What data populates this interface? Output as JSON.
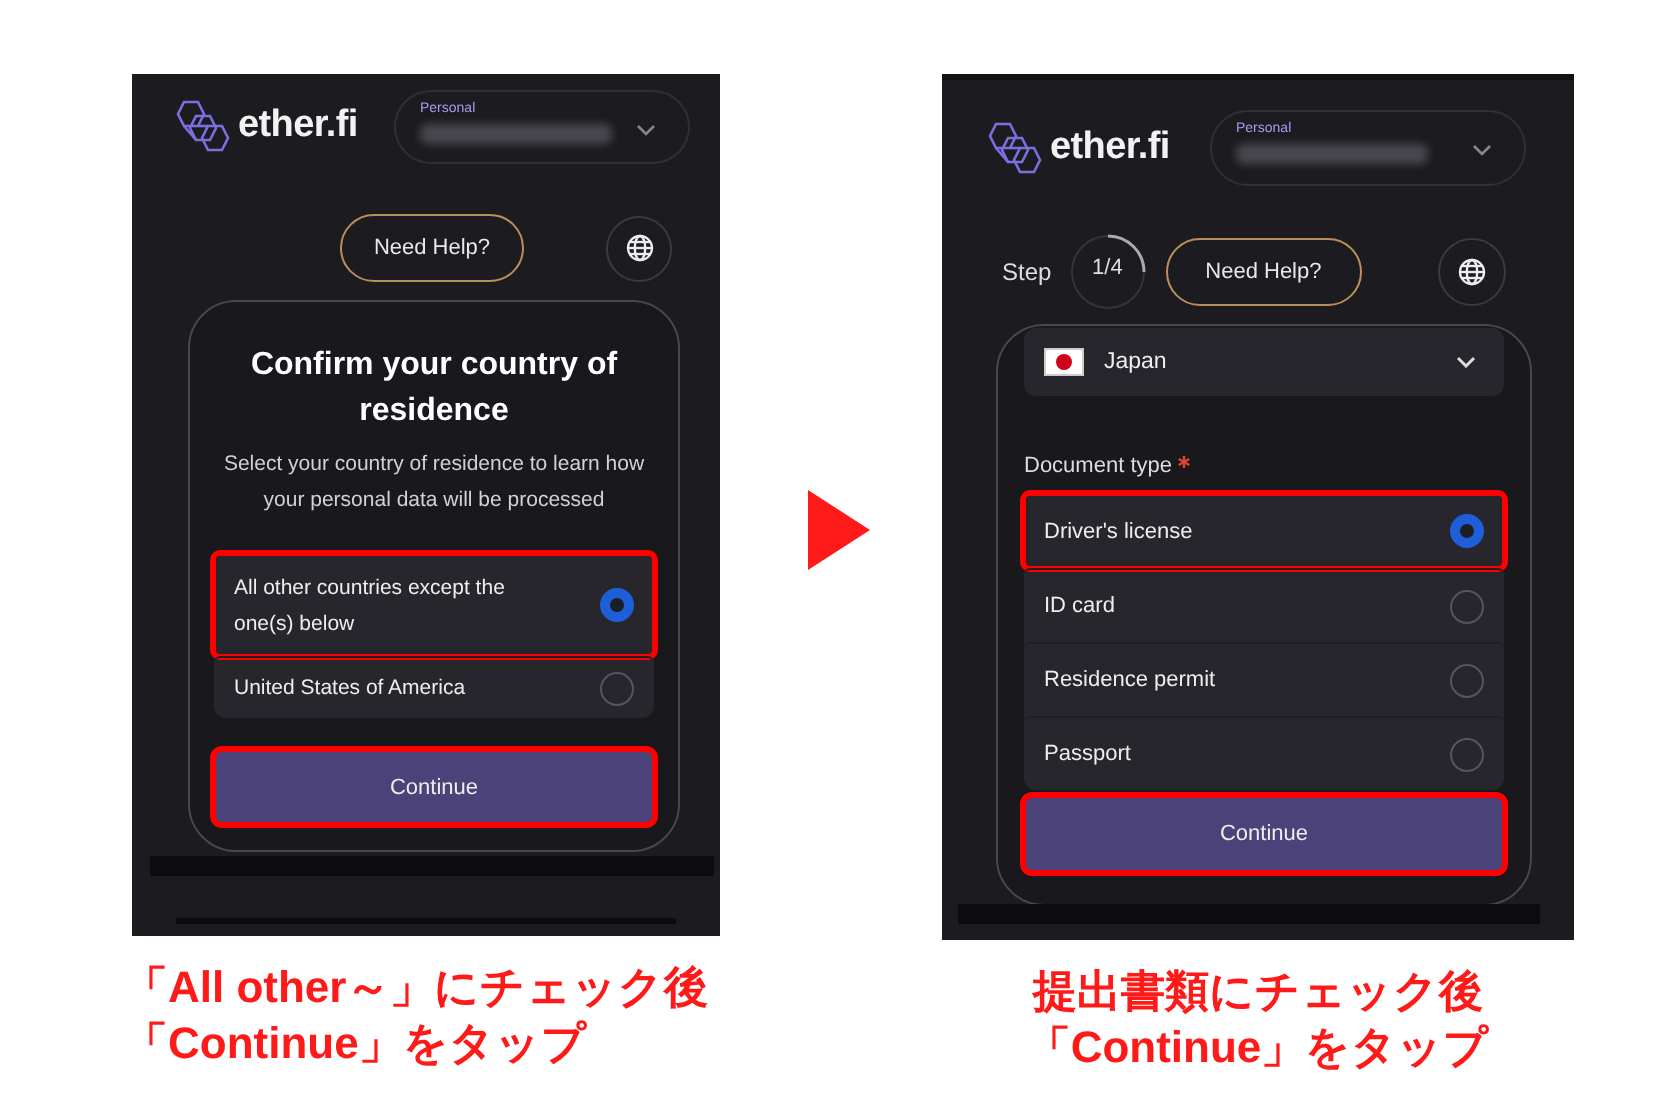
{
  "screens": [
    {
      "logo": "ether.fi",
      "account": {
        "label": "Personal"
      },
      "help_button": "Need Help?",
      "card": {
        "title": "Confirm your country of residence",
        "subtitle": "Select your country of residence to learn how your personal data will be processed",
        "options": [
          {
            "label": "All other countries except the one(s) below",
            "selected": true,
            "highlighted": true
          },
          {
            "label": "United States of America",
            "selected": false,
            "highlighted": false
          }
        ],
        "continue": {
          "label": "Continue",
          "highlighted": true
        }
      },
      "caption": [
        "「All other～」にチェック後",
        "「Continue」をタップ"
      ]
    },
    {
      "logo": "ether.fi",
      "account": {
        "label": "Personal"
      },
      "step": {
        "label": "Step",
        "value": "1/4"
      },
      "help_button": "Need Help?",
      "card": {
        "country": "Japan",
        "field_label": {
          "text": "Document type",
          "required": true
        },
        "options": [
          {
            "label": "Driver's license",
            "selected": true,
            "highlighted": true
          },
          {
            "label": "ID card",
            "selected": false,
            "highlighted": false
          },
          {
            "label": "Residence permit",
            "selected": false,
            "highlighted": false
          },
          {
            "label": "Passport",
            "selected": false,
            "highlighted": false
          }
        ],
        "continue": {
          "label": "Continue",
          "highlighted": true
        }
      },
      "caption": [
        "提出書類にチェック後",
        "「Continue」をタップ"
      ]
    }
  ]
}
